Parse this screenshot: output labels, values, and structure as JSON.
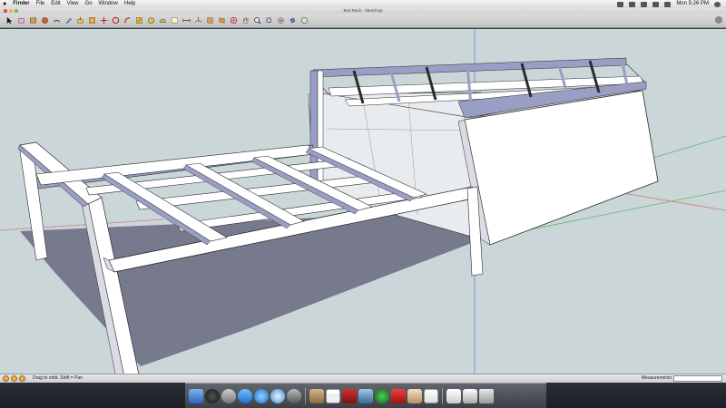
{
  "menubar": {
    "apple": "",
    "app_name": "Finder",
    "menus": [
      "File",
      "Edit",
      "View",
      "Go",
      "Window",
      "Help"
    ],
    "clock": "Mon 5:26 PM"
  },
  "window": {
    "title": "Bed Rack - SketchUp"
  },
  "toolbar": {
    "tools": [
      "select-tool",
      "eraser-tool",
      "rectangle-tool",
      "circle-tool",
      "arc-tool",
      "pencil-tool",
      "push-pull-tool",
      "offset-tool",
      "move-tool",
      "rotate-tool",
      "follow-me-tool",
      "scale-tool",
      "tape-measure-tool",
      "protractor-tool",
      "text-tool",
      "dimension-tool",
      "axes-tool",
      "3d-text-tool",
      "section-plane-tool",
      "orbit-tool",
      "pan-tool",
      "zoom-tool",
      "zoom-window-tool",
      "zoom-extents-tool",
      "paint-bucket-tool",
      "walk-tool"
    ]
  },
  "colors": {
    "sky": "#cbd6d9",
    "ground": "#777a8c",
    "face_front": "#ffffff",
    "face_back": "#9a9ec4",
    "edge": "#2b2b2b"
  },
  "statusbar": {
    "hint": "Drag to orbit.  Shift = Pan",
    "measurements_label": "Measurements",
    "measurements_value": ""
  },
  "dock": {
    "items": [
      "finder",
      "dashboard",
      "launchpad",
      "app-store",
      "itunes",
      "safari",
      "system-preferences",
      "address-book",
      "ical",
      "photo-booth",
      "iphoto",
      "time-machine",
      "sketchup",
      "preview",
      "textedit",
      "documents",
      "downloads",
      "trash"
    ]
  }
}
